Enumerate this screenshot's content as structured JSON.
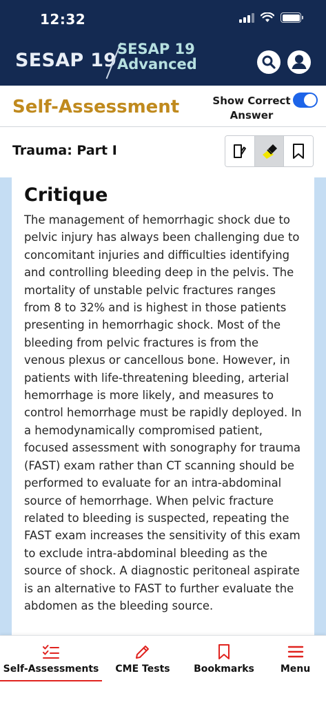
{
  "status_bar": {
    "time": "12:32"
  },
  "header": {
    "logo_left": "SESAP 19",
    "logo_right_line1": "SESAP 19",
    "logo_right_line2": "Advanced",
    "icons": [
      "search-icon",
      "account-icon"
    ]
  },
  "section": {
    "title": "Self-Assessment",
    "toggle_label_line1": "Show Correct",
    "toggle_label_line2": "Answer",
    "toggle_on": true
  },
  "test": {
    "title": "Trauma: Part I",
    "tools": [
      "notes-icon",
      "highlighter-icon",
      "bookmark-icon"
    ],
    "active_tool": "highlighter-icon"
  },
  "critique": {
    "title": "Critique",
    "body": "The management of hemorrhagic shock due to pelvic injury has always been challenging due to concomitant injuries and difficulties identifying and controlling bleeding deep in the pelvis. The mortality of unstable pelvic fractures ranges from 8 to 32% and is highest in those patients presenting in hemorrhagic shock. Most of the bleeding from pelvic fractures is from the venous plexus or cancellous bone. However, in patients with life-threatening bleeding, arterial hemorrhage is more likely, and measures to control hemorrhage must be rapidly deployed. In a hemodynamically compromised patient, focused assessment with sonography for trauma (FAST) exam rather than CT scanning should be performed to evaluate for an intra-abdominal source of hemorrhage. When pelvic fracture related to bleeding is suspected, repeating the FAST exam increases the sensitivity of this exam to exclude intra-abdominal bleeding as the source of shock. A diagnostic peritoneal aspirate is an alternative to FAST to further evaluate the abdomen as the bleeding source."
  },
  "bottom_nav": {
    "items": [
      {
        "label": "Self-Assessments",
        "icon": "checklist-icon",
        "active": true
      },
      {
        "label": "CME Tests",
        "icon": "pencil-icon",
        "active": false
      },
      {
        "label": "Bookmarks",
        "icon": "bookmark-icon",
        "active": false
      },
      {
        "label": "Menu",
        "icon": "hamburger-menu-icon",
        "active": false
      }
    ]
  },
  "colors": {
    "header_bg": "#142a52",
    "section_title": "#c08a1e",
    "toggle_on": "#1d64e8",
    "content_bg": "#c5ddf3",
    "nav_accent": "#e0231f"
  }
}
